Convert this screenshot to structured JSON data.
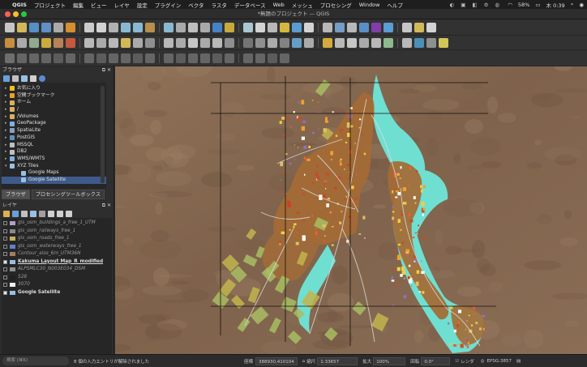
{
  "menubar": {
    "app": "QGIS",
    "items": [
      "プロジェクト",
      "編集",
      "ビュー",
      "レイヤ",
      "設定",
      "プラグイン",
      "ベクタ",
      "ラスタ",
      "データベース",
      "Web",
      "メッシュ",
      "プロセシング",
      "Window",
      "ヘルプ"
    ],
    "battery": "58%",
    "clock": "木 0:39"
  },
  "window": {
    "title": "*無題のプロジェクト — QGIS"
  },
  "browser": {
    "title": "ブラウザ",
    "items": [
      {
        "label": "お気に入り",
        "icon": "star-icon",
        "color": "#f0c020"
      },
      {
        "label": "空間ブックマーク",
        "icon": "bookmark-icon",
        "color": "#e8a030"
      },
      {
        "label": "ホーム",
        "icon": "home-folder-icon",
        "color": "#d8b060"
      },
      {
        "label": "/",
        "icon": "folder-icon",
        "color": "#d8b060"
      },
      {
        "label": "/Volumes",
        "icon": "folder-icon",
        "color": "#d8b060"
      },
      {
        "label": "GeoPackage",
        "icon": "geopackage-icon",
        "color": "#7fb0e0"
      },
      {
        "label": "SpatiaLite",
        "icon": "spatialite-icon",
        "color": "#8aa0c0"
      },
      {
        "label": "PostGIS",
        "icon": "postgis-icon",
        "color": "#5f8fc0"
      },
      {
        "label": "MSSQL",
        "icon": "mssql-icon",
        "color": "#c0c0c0"
      },
      {
        "label": "DB2",
        "icon": "db2-icon",
        "color": "#c0c0c0"
      },
      {
        "label": "WMS/WMTS",
        "icon": "wms-icon",
        "color": "#7fb0e0"
      },
      {
        "label": "XYZ Tiles",
        "icon": "xyz-tiles-icon",
        "color": "#9ac0e0"
      },
      {
        "label": "Google Maps",
        "icon": "tile-layer-icon",
        "color": "#9ac0e0"
      },
      {
        "label": "Google Satellite",
        "icon": "tile-layer-icon",
        "color": "#9ac0e0"
      }
    ]
  },
  "tabs": [
    "ブラウザ",
    "プロセシングツールボックス"
  ],
  "layers": {
    "title": "レイヤ",
    "items": [
      {
        "label": "gis_osm_buildings_a_free_1_UTM",
        "on": false,
        "swatch": "#b0a0c8"
      },
      {
        "label": "gis_osm_railways_free_1",
        "on": false,
        "swatch": "#888888"
      },
      {
        "label": "gis_osm_roads_free_1",
        "on": false,
        "swatch": "#c8b060"
      },
      {
        "label": "gis_osm_waterways_free_1",
        "on": false,
        "swatch": "#6080d0"
      },
      {
        "label": "Contour_alos_6m_UTM36N",
        "on": false,
        "swatch": "#a08060"
      },
      {
        "label": "Kakuma Layout Map_R_modified",
        "on": true,
        "swatch": "#9ac0e0"
      },
      {
        "label": "ALPSMLC30_N003E034_DSM",
        "on": false,
        "swatch": "#909090"
      },
      {
        "label": "528",
        "on": false,
        "swatch": "#202020"
      },
      {
        "label": "3070",
        "on": false,
        "swatch": "#f0f0f0"
      },
      {
        "label": "Google Satellite",
        "on": true,
        "swatch": "#9ac0e0"
      }
    ]
  },
  "status": {
    "search_placeholder": "検索 (⌘K)",
    "message": "8 個の入力エントリが解除されました",
    "coord_label": "座標",
    "coord": "388930,410104",
    "scale_label": "縮尺",
    "scale": "1:33657",
    "magnifier_label": "拡大",
    "magnifier": "100%",
    "rotation_label": "回転",
    "rotation": "0.0°",
    "render_label": "レンダ",
    "crs": "EPSG:3857"
  },
  "colors": {
    "accent": "#3d5a8a",
    "water": "#6ee6d8",
    "settlement": "#b57a3a",
    "terrain": "#8a6a52"
  }
}
